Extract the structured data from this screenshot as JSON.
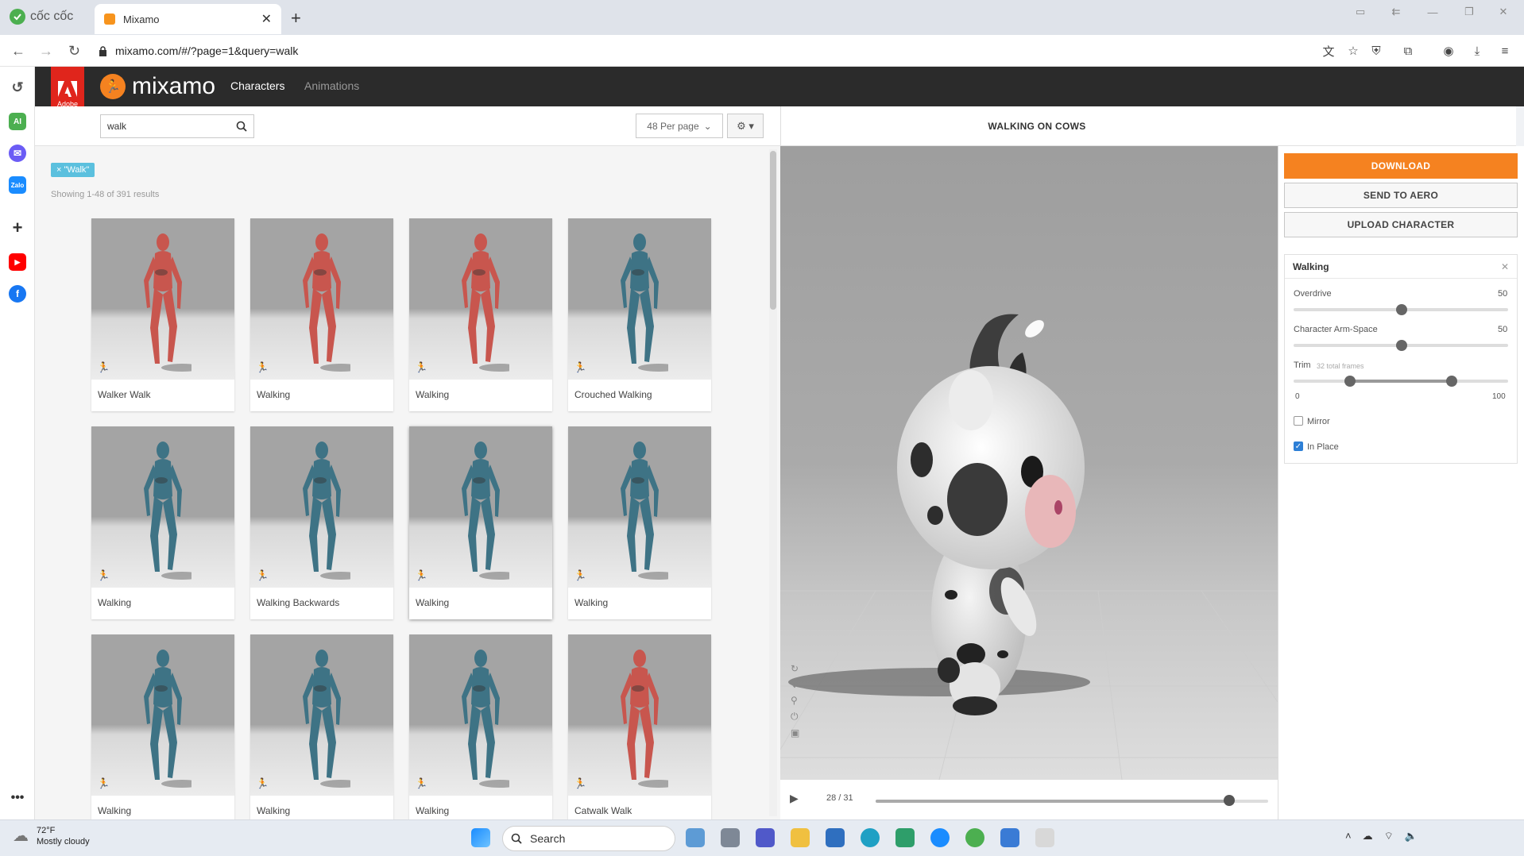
{
  "browser": {
    "brand": "cốc cốc",
    "tab_title": "Mixamo",
    "url": "mixamo.com/#/?page=1&query=walk"
  },
  "app": {
    "logo_text": "mixamo",
    "adobe_label": "Adobe",
    "nav": [
      "Characters",
      "Animations"
    ]
  },
  "search": {
    "value": "walk",
    "per_page": "48 Per page"
  },
  "filter_tag": "× \"Walk\"",
  "results_text": "Showing 1-48 of 391 results",
  "cards": [
    {
      "label": "Walker Walk",
      "color": "#c8564e"
    },
    {
      "label": "Walking",
      "color": "#c8564e"
    },
    {
      "label": "Walking",
      "color": "#c8564e"
    },
    {
      "label": "Crouched Walking",
      "color": "#3e7385"
    },
    {
      "label": "Walking",
      "color": "#3e7385"
    },
    {
      "label": "Walking Backwards",
      "color": "#3e7385"
    },
    {
      "label": "Walking",
      "color": "#3e7385"
    },
    {
      "label": "Walking",
      "color": "#3e7385"
    },
    {
      "label": "Walking",
      "color": "#3e7385"
    },
    {
      "label": "Walking",
      "color": "#3e7385"
    },
    {
      "label": "Walking",
      "color": "#3e7385"
    },
    {
      "label": "Catwalk Walk",
      "color": "#c8564e"
    }
  ],
  "viewer": {
    "title": "WALKING ON COWS",
    "frames": "28 / 31",
    "progress": 0.9
  },
  "actions": {
    "download": "DOWNLOAD",
    "send": "SEND TO AERO",
    "upload": "UPLOAD CHARACTER"
  },
  "settings": {
    "title": "Walking",
    "overdrive_label": "Overdrive",
    "overdrive_value": "50",
    "armspace_label": "Character Arm-Space",
    "armspace_value": "50",
    "trim_label": "Trim",
    "trim_note": "32 total frames",
    "trim_min": "0",
    "trim_max": "100",
    "mirror_label": "Mirror",
    "mirror_checked": false,
    "inplace_label": "In Place",
    "inplace_checked": true
  },
  "taskbar": {
    "temp": "72°F",
    "weather": "Mostly cloudy",
    "search_placeholder": "Search"
  }
}
